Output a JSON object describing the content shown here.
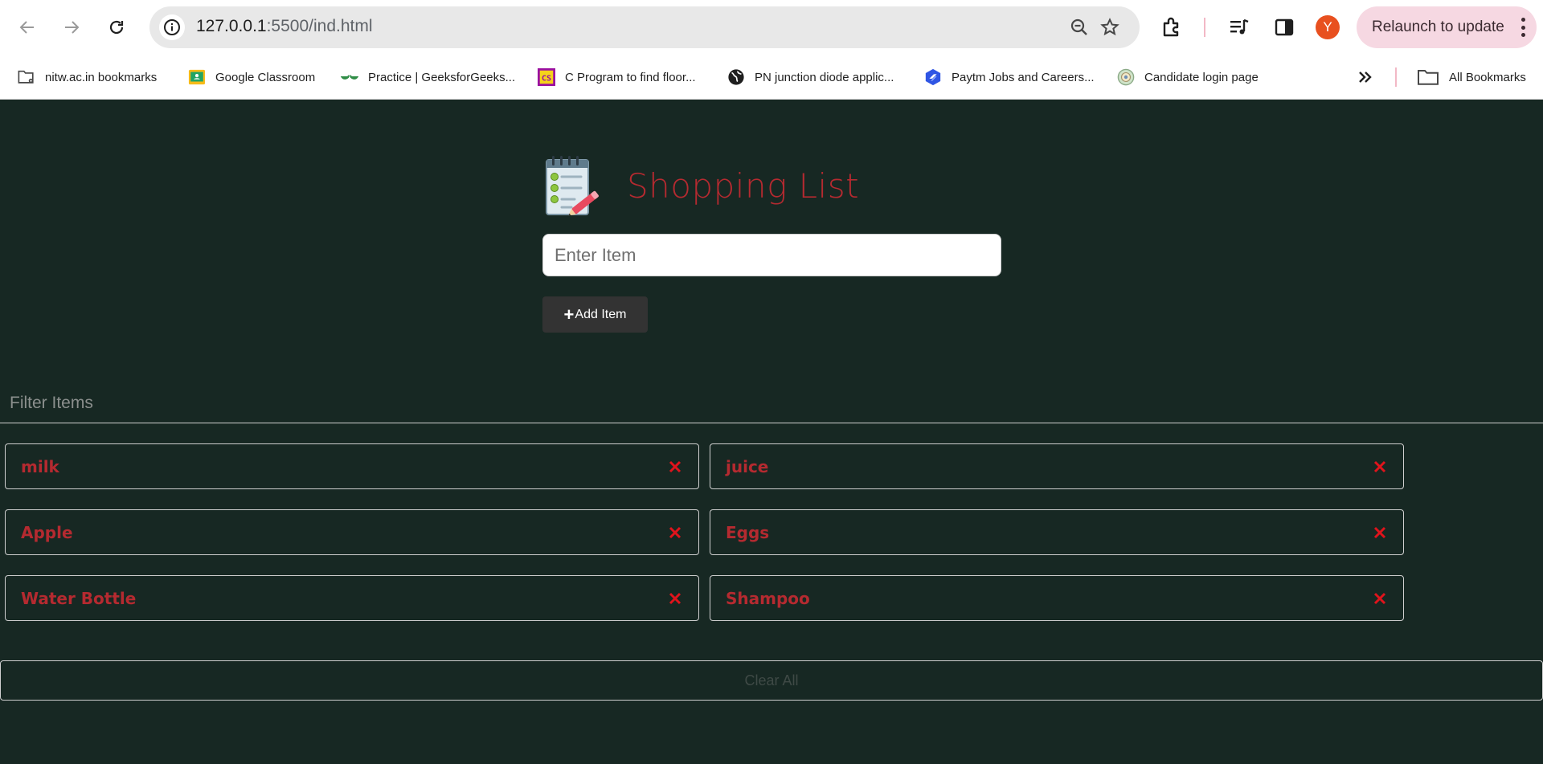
{
  "browser": {
    "url_host": "127.0.0.1",
    "url_rest": ":5500/ind.html",
    "avatar_letter": "Y",
    "relaunch_label": "Relaunch to update",
    "bookmarks": [
      {
        "label": "nitw.ac.in bookmarks",
        "icon": "folder-gear-icon"
      },
      {
        "label": "Google Classroom",
        "icon": "google-classroom-icon"
      },
      {
        "label": "Practice | GeeksforGeeks...",
        "icon": "geeksforgeeks-icon"
      },
      {
        "label": "C Program to find floor...",
        "icon": "codescracker-icon"
      },
      {
        "label": "PN junction diode applic...",
        "icon": "globe-icon"
      },
      {
        "label": "Paytm Jobs and Careers...",
        "icon": "paytm-jobs-icon"
      },
      {
        "label": "Candidate login page",
        "icon": "seal-icon"
      }
    ],
    "all_bookmarks_label": "All Bookmarks"
  },
  "app": {
    "title": "Shopping List",
    "input_placeholder": "Enter Item",
    "add_button_label": "Add Item",
    "filter_placeholder": "Filter Items",
    "items": [
      "milk",
      "juice",
      "Apple",
      "Eggs",
      "Water Bottle",
      "Shampoo"
    ],
    "clear_button_label": "Clear All"
  },
  "colors": {
    "page_background": "#172823",
    "title_color": "#b52a30",
    "remove_icon_color": "#e0141c",
    "add_button_background": "#333333"
  }
}
